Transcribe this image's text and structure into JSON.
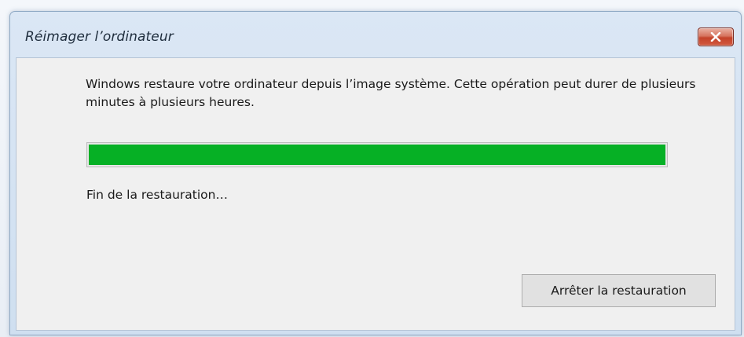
{
  "window": {
    "title": "Réimager l’ordinateur",
    "close_icon": "close-icon"
  },
  "dialog": {
    "message": "Windows restaure votre ordinateur depuis l’image système. Cette opération peut durer de plusieurs minutes à plusieurs heures.",
    "progress": {
      "percent": 100,
      "color": "#06b025"
    },
    "status": "Fin de la restauration…",
    "stop_button_label": "Arrêter la restauration"
  }
}
